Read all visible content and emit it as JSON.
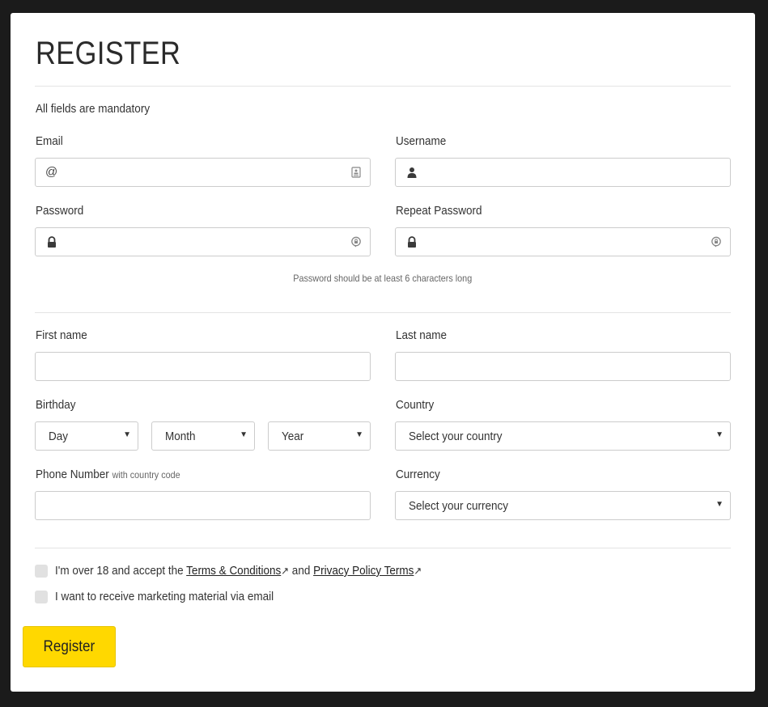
{
  "page": {
    "title": "REGISTER",
    "mandatory_note": "All fields are mandatory"
  },
  "fields": {
    "email": {
      "label": "Email",
      "prefix": "@",
      "value": "",
      "leading_icon": "at-sign-icon",
      "trailing_icon": "contact-card-icon"
    },
    "username": {
      "label": "Username",
      "value": "",
      "leading_icon": "user-icon"
    },
    "password": {
      "label": "Password",
      "value": "",
      "leading_icon": "lock-icon",
      "trailing_icon": "password-reveal-icon"
    },
    "repeat_password": {
      "label": "Repeat Password",
      "value": "",
      "leading_icon": "lock-icon",
      "trailing_icon": "password-reveal-icon"
    },
    "password_hint": "Password should be at least 6 characters long",
    "first_name": {
      "label": "First name",
      "value": ""
    },
    "last_name": {
      "label": "Last name",
      "value": ""
    },
    "birthday": {
      "label": "Birthday",
      "day": {
        "selected": "Day"
      },
      "month": {
        "selected": "Month"
      },
      "year": {
        "selected": "Year"
      }
    },
    "country": {
      "label": "Country",
      "selected": "Select your country"
    },
    "phone": {
      "label": "Phone Number",
      "sublabel": "with country code",
      "value": ""
    },
    "currency": {
      "label": "Currency",
      "selected": "Select your currency"
    }
  },
  "agreements": {
    "terms": {
      "prefix": "I'm over 18 and accept the ",
      "terms_link": "Terms & Conditions",
      "middle": " and ",
      "privacy_link": "Privacy Policy Terms",
      "checked": false
    },
    "marketing": {
      "label": "I want to receive marketing material via email",
      "checked": false
    }
  },
  "actions": {
    "register_label": "Register"
  },
  "colors": {
    "accent": "#ffd800",
    "background": "#1b1b1b",
    "card": "#ffffff"
  }
}
